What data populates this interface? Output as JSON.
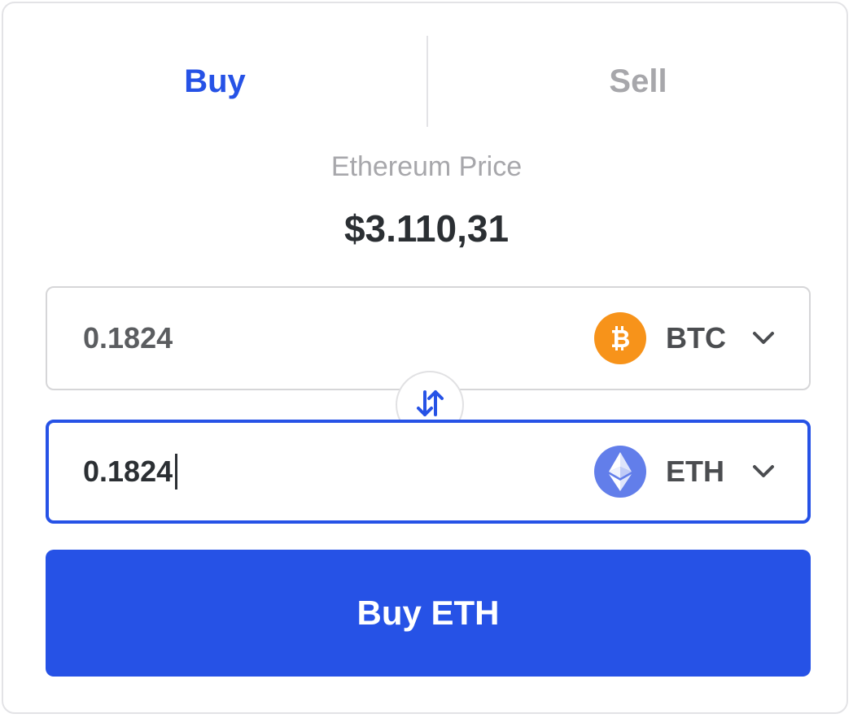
{
  "colors": {
    "accent": "#2652e6",
    "inactive_tab": "#a7a7ab",
    "btc": "#f7931a",
    "eth": "#627eea"
  },
  "tabs": {
    "buy_label": "Buy",
    "sell_label": "Sell",
    "active": "Buy"
  },
  "price": {
    "label": "Ethereum Price",
    "value": "$3.110,31"
  },
  "from_field": {
    "amount": "0.1824",
    "coin_symbol": "BTC",
    "coin_icon": "bitcoin-icon"
  },
  "to_field": {
    "amount": "0.1824",
    "coin_symbol": "ETH",
    "coin_icon": "ethereum-icon",
    "focused": true
  },
  "swap": {
    "icon": "swap-arrows-icon"
  },
  "buy_button": {
    "label": "Buy ETH"
  }
}
